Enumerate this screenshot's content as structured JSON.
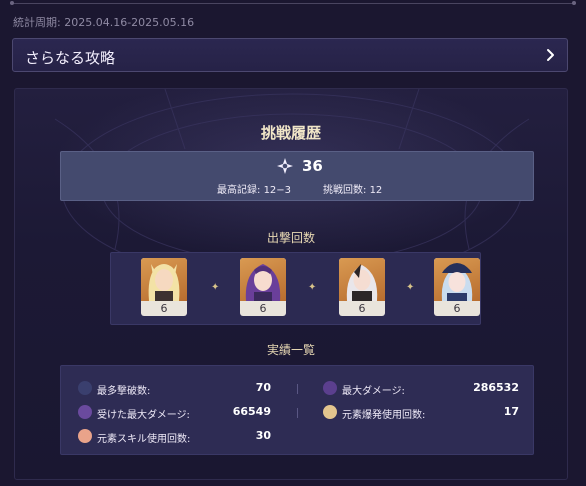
{
  "period": {
    "label": "統計周期:",
    "value": "2025.04.16-2025.05.16"
  },
  "more_button": {
    "label": "さらなる攻略"
  },
  "history": {
    "title": "挑戦履歴",
    "score": "36",
    "best_label": "最高記録:",
    "best_value": "12−3",
    "attempts_label": "挑戦回数:",
    "attempts_value": "12"
  },
  "deployment": {
    "title": "出撃回数",
    "characters": [
      {
        "icon": "blonde-character-portrait",
        "count": "6"
      },
      {
        "icon": "purple-haired-character-portrait",
        "count": "6"
      },
      {
        "icon": "white-haired-character-portrait",
        "count": "6"
      },
      {
        "icon": "blue-haired-character-portrait",
        "count": "6"
      }
    ]
  },
  "achievements": {
    "title": "実績一覧",
    "stats": [
      {
        "label": "最多撃破数:",
        "value": "70"
      },
      {
        "label": "最大ダメージ:",
        "value": "286532"
      },
      {
        "label": "受けた最大ダメージ:",
        "value": "66549"
      },
      {
        "label": "元素爆発使用回数:",
        "value": "17"
      },
      {
        "label": "元素スキル使用回数:",
        "value": "30"
      }
    ]
  },
  "colors": {
    "accent_gold": "#e8d9b4",
    "panel_bg": "#1c1935",
    "card_bg": "#d99a52"
  }
}
